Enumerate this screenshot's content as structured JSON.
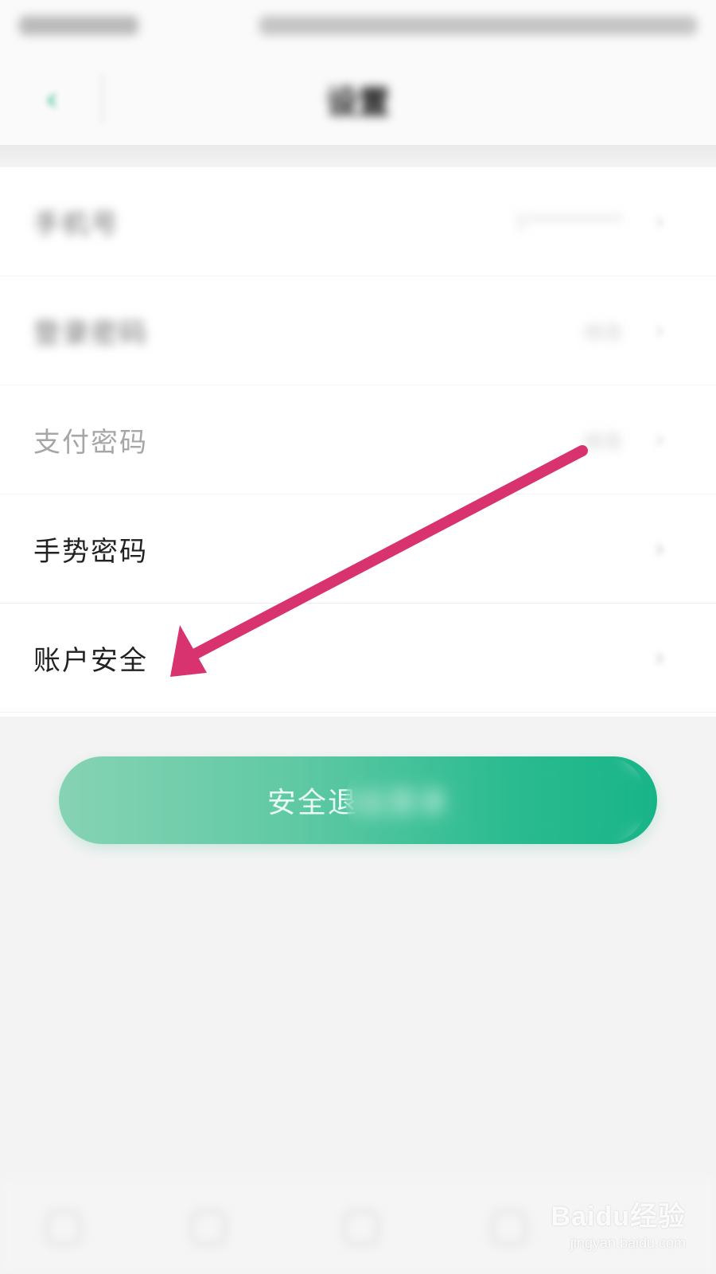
{
  "header": {
    "title": "设置",
    "back_icon": "chevron-left-icon",
    "accent": "#2ab586"
  },
  "list": {
    "items": [
      {
        "label": "手机号",
        "value": "1**********",
        "state": "blurred"
      },
      {
        "label": "登录密码",
        "value": "修改",
        "state": "blurred"
      },
      {
        "label": "支付密码",
        "value": "修改",
        "state": "dim"
      },
      {
        "label": "手势密码",
        "value": "",
        "state": "normal"
      },
      {
        "label": "账户安全",
        "value": "",
        "state": "normal"
      }
    ]
  },
  "logout": {
    "label": "安全退出登录"
  },
  "annotation": {
    "arrow_color": "#d8336f"
  },
  "watermark": {
    "main": "Baidu经验",
    "sub": "jingyan.baidu.com"
  }
}
